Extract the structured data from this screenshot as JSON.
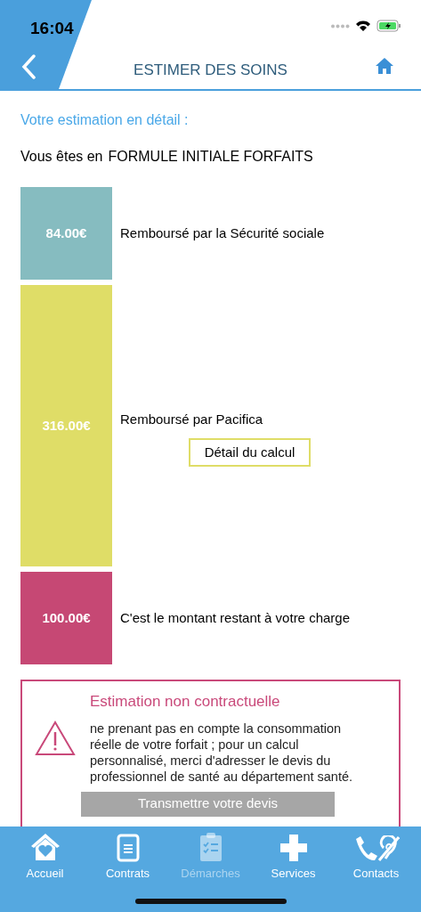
{
  "status_bar": {
    "time": "16:04"
  },
  "header": {
    "title": "ESTIMER DES SOINS"
  },
  "intro": {
    "heading": "Votre estimation en détail :",
    "formula_prefix": "Vous êtes en",
    "formula": "FORMULE INITIALE FORFAITS"
  },
  "segments": [
    {
      "amount": "84.00€",
      "label": "Remboursé par la Sécurité sociale",
      "color": "#86bcc0"
    },
    {
      "amount": "316.00€",
      "label": "Remboursé par Pacifica",
      "color": "#dfdd67",
      "button": "Détail du calcul"
    },
    {
      "amount": "100.00€",
      "label": "C'est le montant restant à votre charge",
      "color": "#c64874"
    }
  ],
  "warning": {
    "title": "Estimation non contractuelle",
    "text": "ne prenant pas en compte la consommation réelle de votre forfait ; pour un calcul personnalisé, merci d'adresser le devis du professionnel de santé au département santé.",
    "button": "Transmettre votre devis"
  },
  "tab_bar": [
    {
      "label": "Accueil",
      "disabled": false
    },
    {
      "label": "Contrats",
      "disabled": false
    },
    {
      "label": "Démarches",
      "disabled": true
    },
    {
      "label": "Services",
      "disabled": false
    },
    {
      "label": "Contacts",
      "disabled": false
    }
  ]
}
